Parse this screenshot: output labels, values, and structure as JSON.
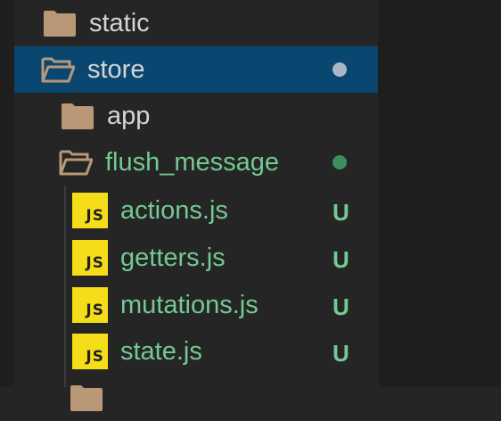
{
  "colors": {
    "selection": "#094771",
    "text_default": "#d4d4d4",
    "git_untracked": "#73c991",
    "dot_selected": "#a9b8c8",
    "dot_modified": "#3f8f5e",
    "js_badge": "#f5de19",
    "folder_fill": "#b89877"
  },
  "tree": {
    "items": [
      {
        "label": "static",
        "icon": "folder-closed-icon"
      },
      {
        "label": "store",
        "icon": "folder-open-icon",
        "selected": true
      },
      {
        "label": "app",
        "icon": "folder-closed-icon"
      },
      {
        "label": "flush_message",
        "icon": "folder-open-icon"
      },
      {
        "label": "actions.js",
        "icon": "js-file-icon",
        "badge": "JS",
        "status": "U"
      },
      {
        "label": "getters.js",
        "icon": "js-file-icon",
        "badge": "JS",
        "status": "U"
      },
      {
        "label": "mutations.js",
        "icon": "js-file-icon",
        "badge": "JS",
        "status": "U"
      },
      {
        "label": "state.js",
        "icon": "js-file-icon",
        "badge": "JS",
        "status": "U"
      },
      {
        "label": "",
        "icon": "folder-closed-icon"
      }
    ]
  }
}
